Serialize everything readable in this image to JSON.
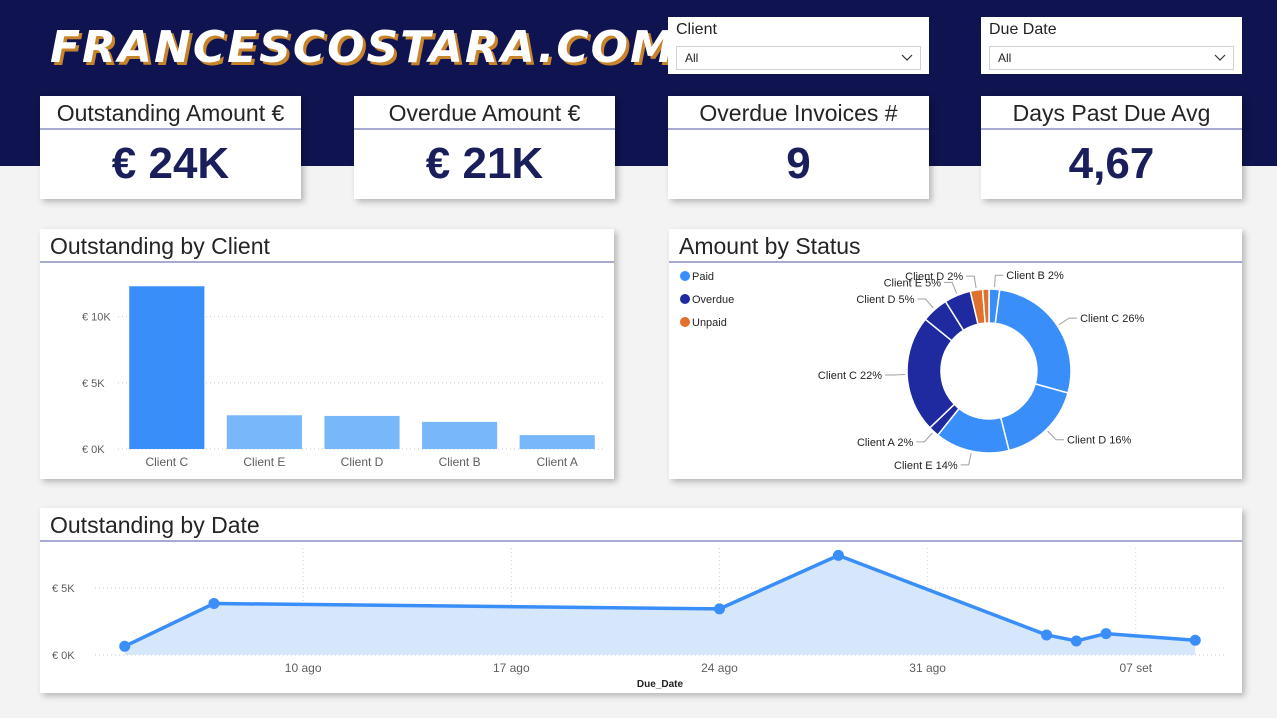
{
  "header": {
    "logo": "FRANCESCOSTARA.COM"
  },
  "filters": {
    "client": {
      "label": "Client",
      "value": "All"
    },
    "due_date": {
      "label": "Due Date",
      "value": "All"
    }
  },
  "kpis": [
    {
      "title": "Outstanding Amount €",
      "value": "€ 24K"
    },
    {
      "title": "Overdue Amount €",
      "value": "€ 21K"
    },
    {
      "title": "Overdue Invoices #",
      "value": "9"
    },
    {
      "title": "Days Past Due Avg",
      "value": "4,67"
    }
  ],
  "colors": {
    "navy": "#0f1450",
    "bar_highlight": "#3a8ef9",
    "bar_light": "#79b7fb",
    "paid": "#3a8ef9",
    "overdue": "#1f2aa0",
    "unpaid": "#e0712c",
    "line": "#3a8ef9",
    "area": "#d6e6fb"
  },
  "titles": {
    "bar": "Outstanding by Client",
    "donut": "Amount by Status",
    "line": "Outstanding by Date"
  },
  "chart_data": [
    {
      "type": "bar",
      "title": "Outstanding by Client",
      "categories": [
        "Client C",
        "Client E",
        "Client D",
        "Client B",
        "Client A"
      ],
      "values": [
        12300,
        2550,
        2500,
        2050,
        1050
      ],
      "ylim": [
        0,
        13000
      ],
      "yticks": [
        0,
        5000,
        10000
      ],
      "ytick_labels": [
        "€ 0K",
        "€ 5K",
        "€ 10K"
      ],
      "grid": true
    },
    {
      "type": "pie",
      "title": "Amount by Status",
      "legend": [
        "Paid",
        "Overdue",
        "Unpaid"
      ],
      "legend_position": "top-left",
      "slices": [
        {
          "status": "Paid",
          "label": "Client B 2%",
          "value": 2
        },
        {
          "status": "Paid",
          "label": "Client C 26%",
          "value": 26
        },
        {
          "status": "Paid",
          "label": "Client D 16%",
          "value": 16
        },
        {
          "status": "Paid",
          "label": "Client E 14%",
          "value": 14
        },
        {
          "status": "Overdue",
          "label": "Client A 2%",
          "value": 2
        },
        {
          "status": "Overdue",
          "label": "Client C 22%",
          "value": 22
        },
        {
          "status": "Overdue",
          "label": "Client D 5%",
          "value": 5
        },
        {
          "status": "Overdue",
          "label": "Client E 5%",
          "value": 5
        },
        {
          "status": "Unpaid",
          "label": "Client D 2%",
          "value": 2.3
        },
        {
          "status": "Unpaid",
          "label": "",
          "value": 1.2
        }
      ]
    },
    {
      "type": "area",
      "title": "Outstanding by Date",
      "xlabel": "Due_Date",
      "x": [
        "2023-08-04",
        "2023-08-07",
        "2023-08-24",
        "2023-08-28",
        "2023-09-04",
        "2023-09-05",
        "2023-09-06",
        "2023-09-09"
      ],
      "values": [
        650,
        3850,
        3450,
        7450,
        1500,
        1050,
        1600,
        1100
      ],
      "xticks": [
        "10 ago",
        "17 ago",
        "24 ago",
        "31 ago",
        "07 set"
      ],
      "yticks": [
        0,
        5000
      ],
      "ytick_labels": [
        "€ 0K",
        "€ 5K"
      ],
      "ylim": [
        0,
        8000
      ],
      "grid": true
    }
  ]
}
